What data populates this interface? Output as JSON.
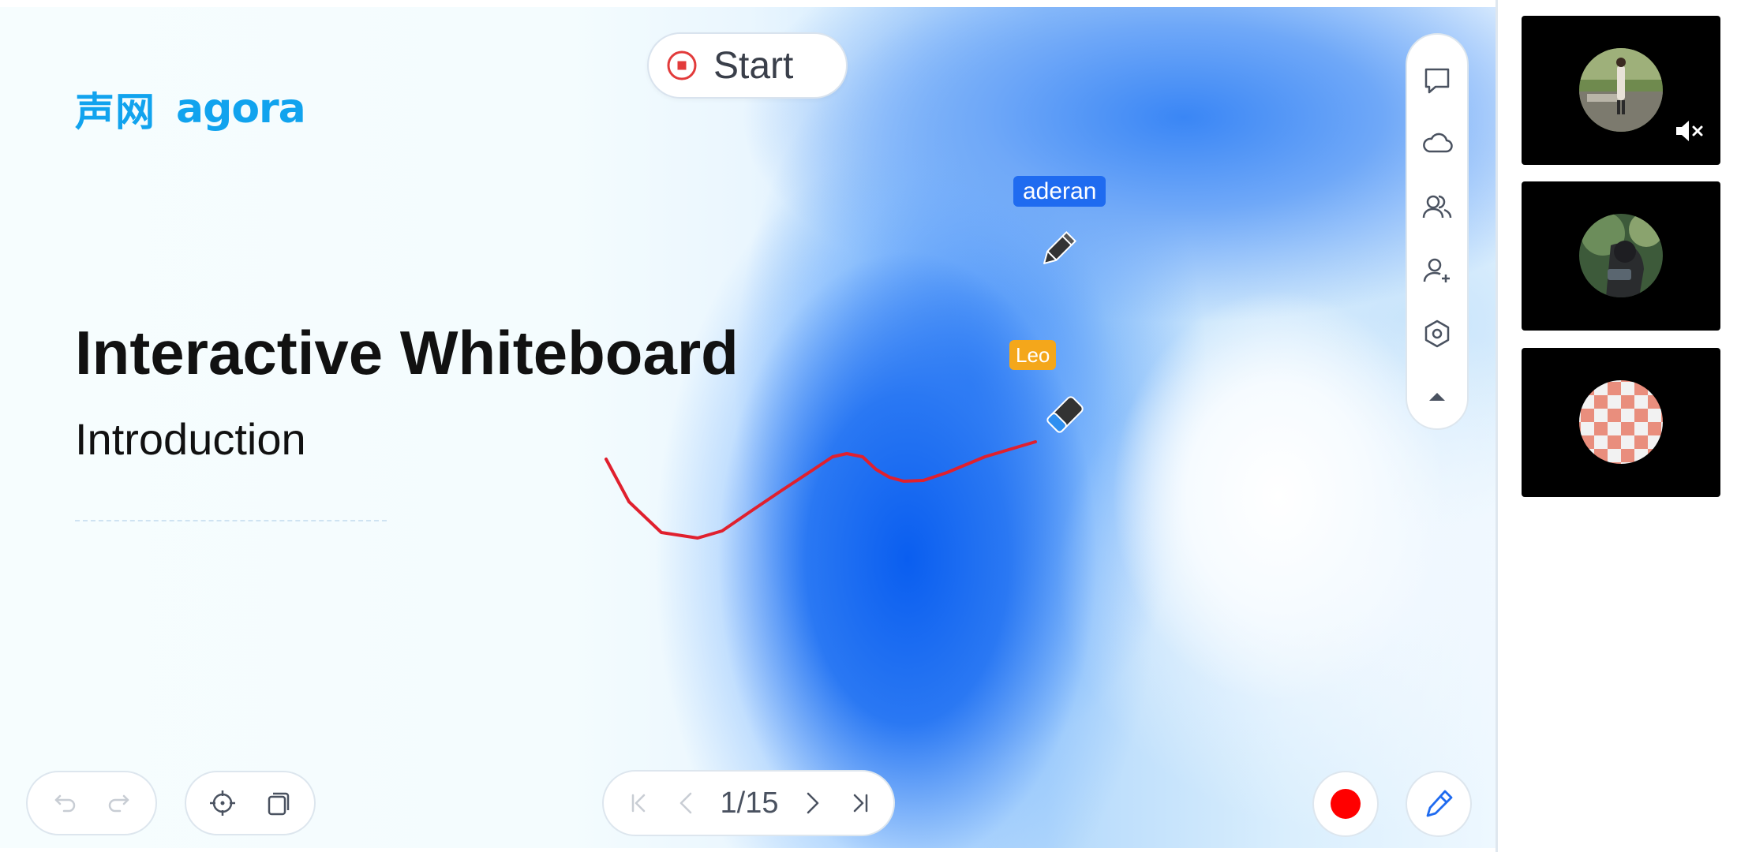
{
  "logo": {
    "cn": "声网",
    "en": "agora"
  },
  "slide": {
    "title": "Interactive Whiteboard",
    "subtitle": "Introduction"
  },
  "recording": {
    "label": "Start"
  },
  "cursors": [
    {
      "name": "aderan",
      "tool": "pencil-icon",
      "color": "#1f6bf0"
    },
    {
      "name": "Leo",
      "tool": "eraser-icon",
      "color": "#f4a71b"
    }
  ],
  "stroke": {
    "color": "#e0202e"
  },
  "right_toolbar": {
    "items": [
      "chat-icon",
      "cloud-icon",
      "users-icon",
      "add-user-icon",
      "settings-icon",
      "collapse-icon"
    ]
  },
  "pager": {
    "current": 1,
    "total": 15,
    "indicator": "1/15"
  },
  "bottom_tools": [
    "undo-icon",
    "redo-icon",
    "locate-icon",
    "pages-icon"
  ],
  "record_button": {
    "color": "#ff0000"
  },
  "participants": [
    {
      "id": "participant-1",
      "muted": true,
      "avatar": "photo"
    },
    {
      "id": "participant-2",
      "muted": false,
      "avatar": "photo"
    },
    {
      "id": "participant-3",
      "muted": false,
      "avatar": "checker"
    }
  ]
}
